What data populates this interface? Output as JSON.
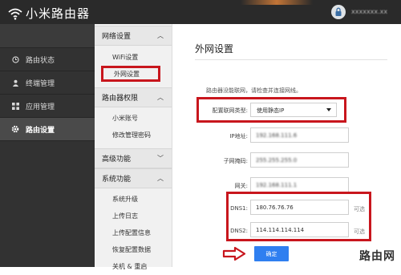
{
  "header": {
    "app_title": "小米路由器",
    "username": "xxxxxxx.xx"
  },
  "left_nav": {
    "items": [
      {
        "label": "路由状态",
        "icon": "clock-icon"
      },
      {
        "label": "终端管理",
        "icon": "user-icon"
      },
      {
        "label": "应用管理",
        "icon": "apps-grid-icon"
      },
      {
        "label": "路由设置",
        "icon": "gear-icon",
        "active": true
      }
    ]
  },
  "sub_nav": {
    "sections": [
      {
        "title": "网络设置",
        "expanded": true,
        "items": [
          "WiFi设置",
          "外网设置"
        ]
      },
      {
        "title": "路由器权限",
        "expanded": true,
        "items": [
          "小米账号",
          "修改管理密码"
        ]
      },
      {
        "title": "高级功能",
        "expanded": false,
        "items": []
      },
      {
        "title": "系统功能",
        "expanded": true,
        "items": [
          "系统升级",
          "上传日志",
          "上传配置信息",
          "恢复配置数据",
          "关机 & 重启"
        ]
      }
    ]
  },
  "main": {
    "title": "外网设置",
    "notice": "路由器没能联网，请检查并连接网线。",
    "conn_type_label": "配置联网类型:",
    "conn_type_value": "使用静态IP",
    "ip_label": "IP地址:",
    "ip_value": "192.168.111.6",
    "mask_label": "子网掩码:",
    "mask_value": "255.255.255.0",
    "gateway_label": "网关:",
    "gateway_value": "192.168.111.1",
    "dns1_label": "DNS1:",
    "dns1_value": "180.76.76.76",
    "dns2_label": "DNS2:",
    "dns2_value": "114.114.114.114",
    "optional_text": "可选",
    "confirm_label": "确定"
  },
  "watermark": "路由网",
  "colors": {
    "header_bg": "#2a2a2a",
    "nav_bg": "#323232",
    "highlight_red": "#c8161d",
    "button_blue": "#2f7ff0"
  }
}
